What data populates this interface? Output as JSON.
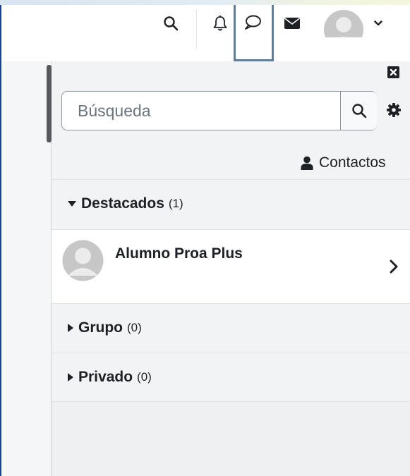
{
  "navbar": {
    "icons": [
      "search-icon",
      "bell-icon",
      "speech-bubble-icon",
      "envelope-icon",
      "user-avatar",
      "chevron-down-icon"
    ]
  },
  "drawer": {
    "search": {
      "placeholder": "Búsqueda"
    },
    "contacts_label": "Contactos",
    "sections": {
      "starred": {
        "label": "Destacados",
        "count": "(1)",
        "expanded": true
      },
      "group": {
        "label": "Grupo",
        "count": "(0)",
        "expanded": false
      },
      "private": {
        "label": "Privado",
        "count": "(0)",
        "expanded": false
      }
    },
    "starred_contacts": [
      {
        "name": "Alumno Proa Plus"
      }
    ]
  },
  "colors": {
    "active_tab_border": "#607d9b",
    "text": "#1d2125",
    "drawer_bg": "#f2f3f5"
  }
}
